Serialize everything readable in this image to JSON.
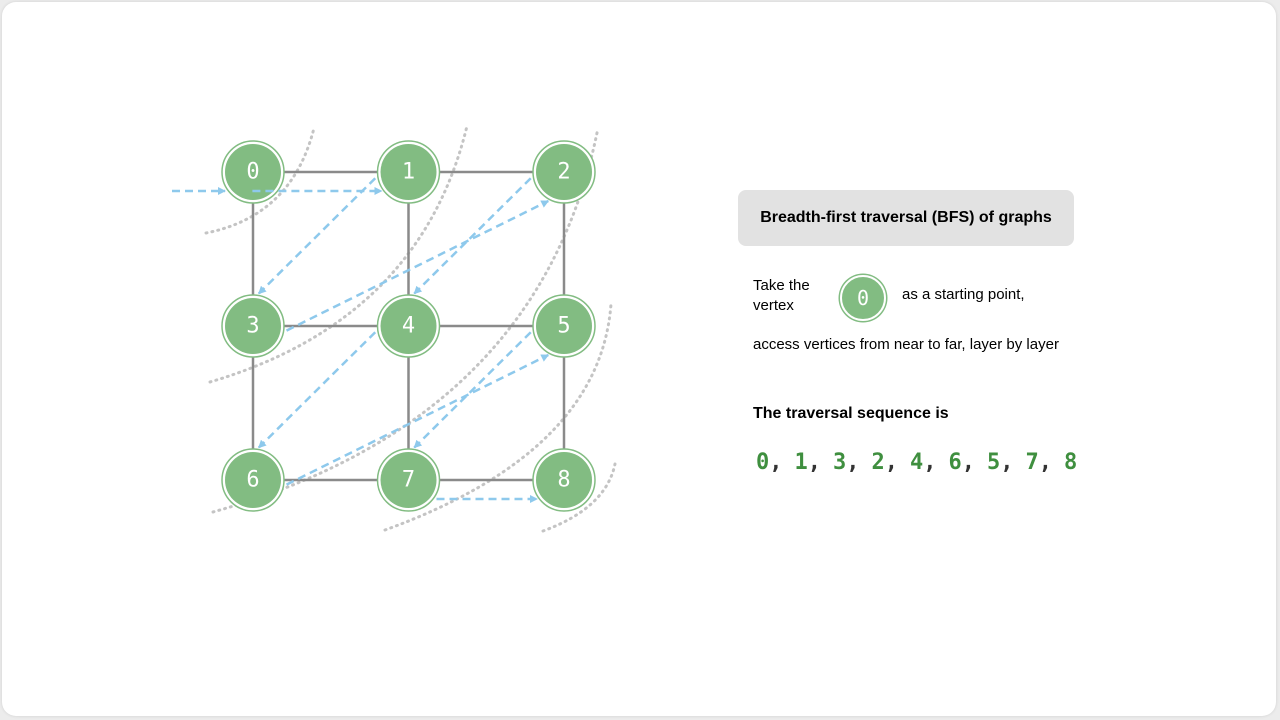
{
  "title": "Breadth-first traversal (BFS) of graphs",
  "description": {
    "prefix": "Take the vertex",
    "start_vertex": "0",
    "suffix": "as a starting point,",
    "line2": "access vertices from near to far, layer by layer"
  },
  "sequence_title": "The traversal sequence is",
  "sequence": [
    "0",
    "1",
    "3",
    "2",
    "4",
    "6",
    "5",
    "7",
    "8"
  ],
  "sequence_separator": ",",
  "graph": {
    "nodes": [
      {
        "id": "0",
        "row": 0,
        "col": 0
      },
      {
        "id": "1",
        "row": 0,
        "col": 1
      },
      {
        "id": "2",
        "row": 0,
        "col": 2
      },
      {
        "id": "3",
        "row": 1,
        "col": 0
      },
      {
        "id": "4",
        "row": 1,
        "col": 1
      },
      {
        "id": "5",
        "row": 1,
        "col": 2
      },
      {
        "id": "6",
        "row": 2,
        "col": 0
      },
      {
        "id": "7",
        "row": 2,
        "col": 1
      },
      {
        "id": "8",
        "row": 2,
        "col": 2
      }
    ],
    "edges": [
      [
        "0",
        "1"
      ],
      [
        "1",
        "2"
      ],
      [
        "3",
        "4"
      ],
      [
        "4",
        "5"
      ],
      [
        "6",
        "7"
      ],
      [
        "7",
        "8"
      ],
      [
        "0",
        "3"
      ],
      [
        "3",
        "6"
      ],
      [
        "1",
        "4"
      ],
      [
        "4",
        "7"
      ],
      [
        "2",
        "5"
      ],
      [
        "5",
        "8"
      ]
    ],
    "traversal_arrows": [
      [
        "start",
        "0"
      ],
      [
        "0",
        "1"
      ],
      [
        "1",
        "3"
      ],
      [
        "3",
        "2"
      ],
      [
        "2",
        "4"
      ],
      [
        "4",
        "6"
      ],
      [
        "6",
        "5"
      ],
      [
        "5",
        "7"
      ],
      [
        "7",
        "8"
      ]
    ]
  },
  "colors": {
    "node_fill": "#82bc82",
    "edge": "#8a8a8a",
    "arrow": "#8ec9ec",
    "layer_curve": "#c4c4c4",
    "sequence_number": "#3f8f3f"
  }
}
